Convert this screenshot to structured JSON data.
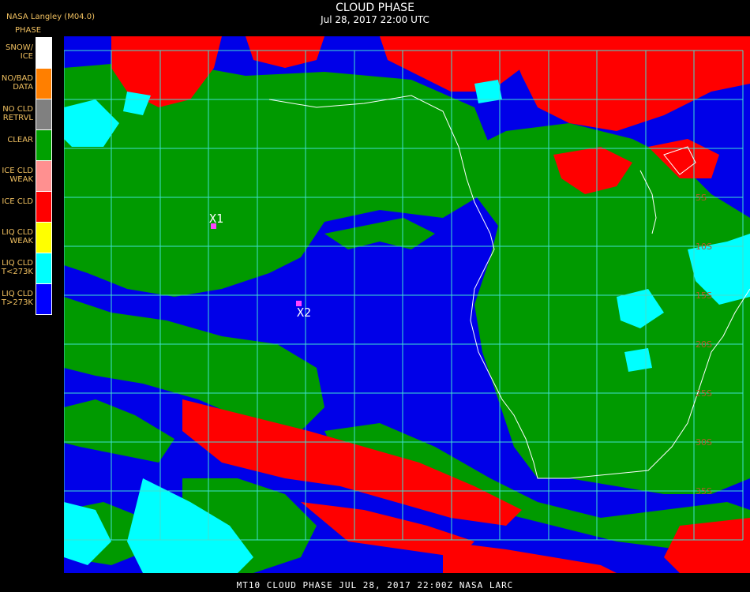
{
  "header": {
    "title": "CLOUD PHASE",
    "subtitle": "Jul 28, 2017 22:00 UTC",
    "org": "NASA Langley (M04.0)"
  },
  "legend": {
    "title": "PHASE",
    "items": [
      {
        "label": "SNOW/\nICE",
        "color": "#ffffff"
      },
      {
        "label": "NO/BAD\nDATA",
        "color": "#ff7f00"
      },
      {
        "label": "NO CLD\nRETRVL",
        "color": "#808080"
      },
      {
        "label": "CLEAR",
        "color": "#00a000"
      },
      {
        "label": "ICE CLD\nWEAK",
        "color": "#ff9090"
      },
      {
        "label": "ICE CLD",
        "color": "#ff0000"
      },
      {
        "label": "LIQ CLD\nWEAK",
        "color": "#ffff00"
      },
      {
        "label": "LIQ CLD\nT<273K",
        "color": "#00ffff"
      },
      {
        "label": "LIQ CLD\nT>273K",
        "color": "#0000ff"
      }
    ]
  },
  "markers": [
    {
      "label": "X1"
    },
    {
      "label": "X2"
    }
  ],
  "lat_ticks": [
    "5S",
    "10S",
    "15S",
    "20S",
    "25S",
    "30S",
    "35S"
  ],
  "footer": "MT10  CLOUD PHASE   JUL 28, 2017 22:00Z   NASA LARC",
  "colors": {
    "background": "#000000",
    "grid": "#40e0d0",
    "coastline": "#ffffff",
    "clear": "#00a000",
    "ice": "#ff0000",
    "liquid_warm": "#0000ff",
    "liquid_cold": "#00ffff"
  }
}
